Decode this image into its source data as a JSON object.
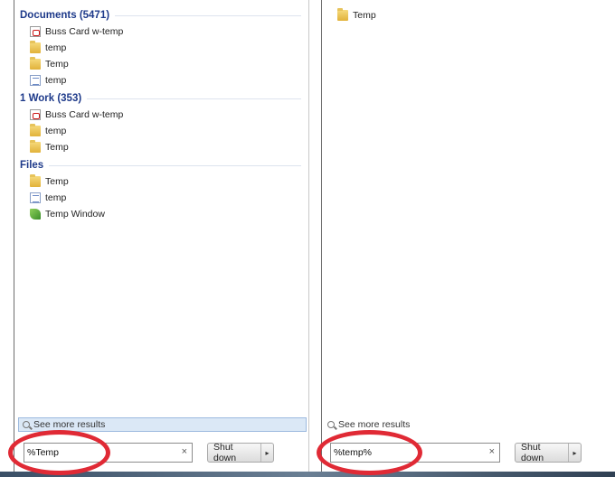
{
  "left_panel": {
    "groups": [
      {
        "title": "Documents (5471)",
        "items": [
          {
            "label": "Buss Card w-temp",
            "icon": "pdf-file-icon"
          },
          {
            "label": "temp",
            "icon": "folder-icon"
          },
          {
            "label": "Temp",
            "icon": "folder-icon"
          },
          {
            "label": "temp",
            "icon": "document-file-icon"
          }
        ]
      },
      {
        "title": "1 Work (353)",
        "items": [
          {
            "label": "Buss Card w-temp",
            "icon": "pdf-file-icon"
          },
          {
            "label": "temp",
            "icon": "folder-icon"
          },
          {
            "label": "Temp",
            "icon": "folder-icon"
          }
        ]
      },
      {
        "title": "Files",
        "items": [
          {
            "label": "Temp",
            "icon": "folder-icon"
          },
          {
            "label": "temp",
            "icon": "document-file-icon"
          },
          {
            "label": "Temp Window",
            "icon": "leaf-file-icon"
          }
        ]
      }
    ],
    "see_more": "See more results",
    "search_value": "%Temp",
    "clear_symbol": "×",
    "shutdown_label": "Shut down",
    "shutdown_arrow": "▸"
  },
  "right_panel": {
    "items": [
      {
        "label": "Temp",
        "icon": "folder-icon"
      }
    ],
    "see_more": "See more results",
    "search_value": "%temp%",
    "clear_symbol": "×",
    "shutdown_label": "Shut down",
    "shutdown_arrow": "▸"
  },
  "colors": {
    "group_header": "#1e3a8a",
    "highlight_oval": "#e02a35",
    "see_more_bar": "#dbe8f6"
  }
}
